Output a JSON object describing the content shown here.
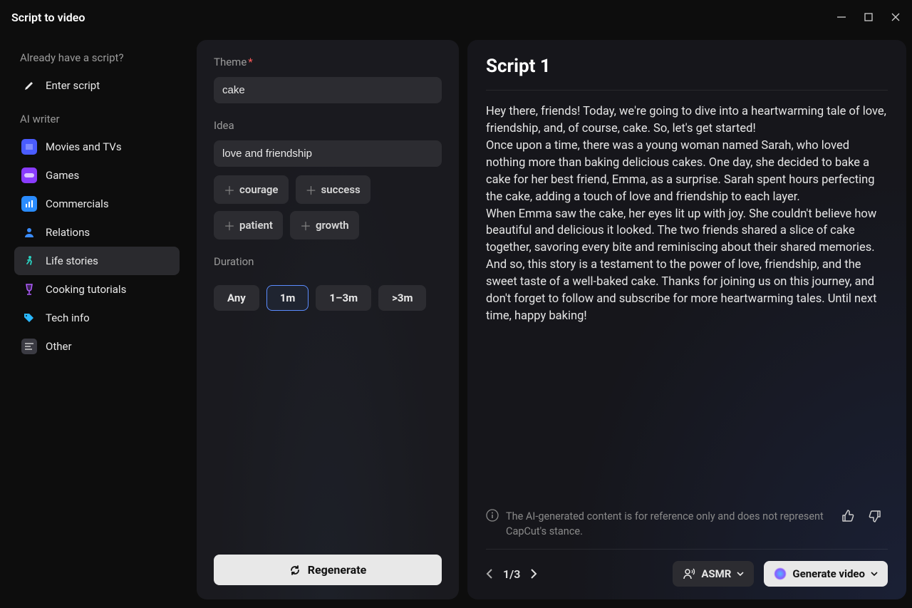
{
  "titlebar": {
    "title": "Script to video"
  },
  "sidebar": {
    "section1": "Already have a script?",
    "enter_script": "Enter script",
    "section2": "AI writer",
    "items": [
      {
        "label": "Movies and TVs"
      },
      {
        "label": "Games"
      },
      {
        "label": "Commercials"
      },
      {
        "label": "Relations"
      },
      {
        "label": "Life stories"
      },
      {
        "label": "Cooking tutorials"
      },
      {
        "label": "Tech info"
      },
      {
        "label": "Other"
      }
    ]
  },
  "form": {
    "theme_label": "Theme",
    "theme_value": "cake",
    "idea_label": "Idea",
    "idea_value": "love and friendship",
    "chips": [
      "courage",
      "success",
      "patient",
      "growth"
    ],
    "duration_label": "Duration",
    "duration_options": [
      "Any",
      "1m",
      "1–3m",
      ">3m"
    ],
    "regenerate": "Regenerate"
  },
  "script": {
    "title": "Script 1",
    "body": "Hey there, friends! Today, we're going to dive into a heartwarming tale of love, friendship, and, of course, cake. So, let's get started!\nOnce upon a time, there was a young woman named Sarah, who loved nothing more than baking delicious cakes. One day, she decided to bake a cake for her best friend, Emma, as a surprise. Sarah spent hours perfecting the cake, adding a touch of love and friendship to each layer.\nWhen Emma saw the cake, her eyes lit up with joy. She couldn't believe how beautiful and delicious it looked. The two friends shared a slice of cake together, savoring every bite and reminiscing about their shared memories.\nAnd so, this story is a testament to the power of love, friendship, and the sweet taste of a well-baked cake. Thanks for joining us on this journey, and don't forget to follow and subscribe for more heartwarming tales. Until next time, happy baking!",
    "disclaimer": "The AI-generated content is for reference only and does not represent CapCut's stance.",
    "pager": "1/3",
    "asmr": "ASMR",
    "generate": "Generate video"
  }
}
